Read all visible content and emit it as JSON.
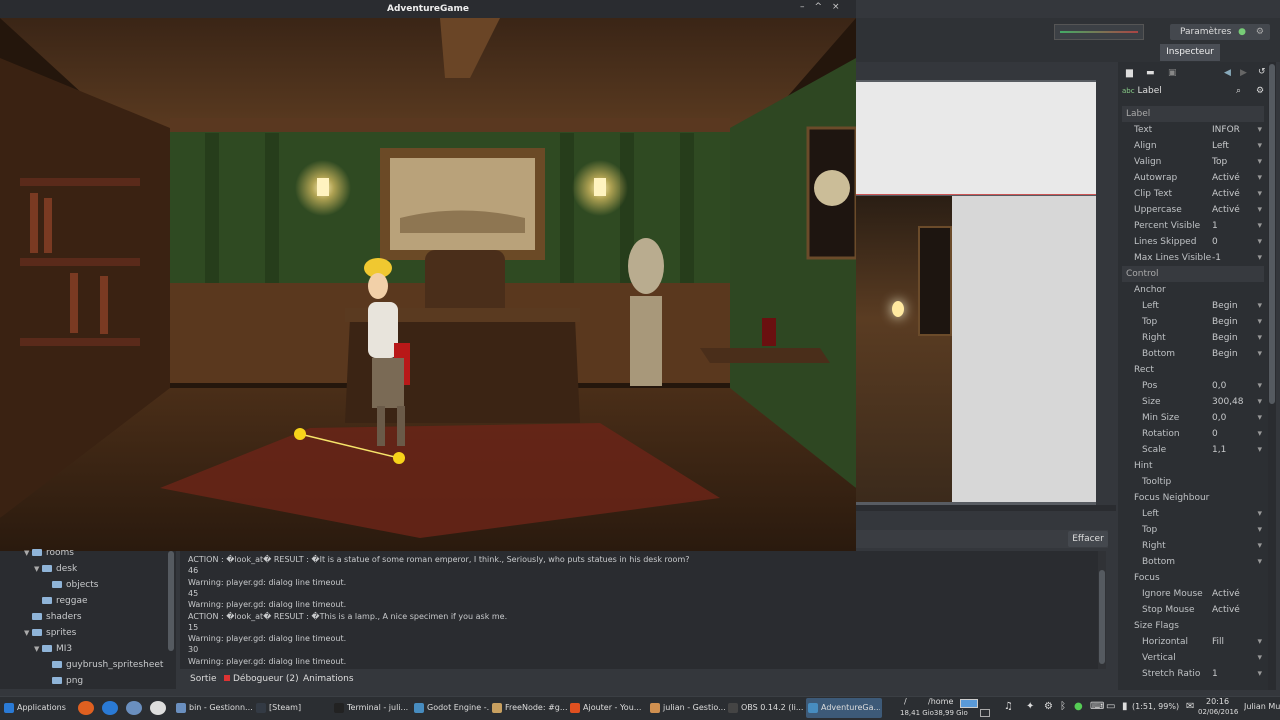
{
  "window": {
    "title": "AdventureGame",
    "controls": [
      "–",
      "^",
      "×"
    ]
  },
  "toolbar": {
    "params_label": "Paramètres",
    "inspector_tab": "Inspecteur"
  },
  "inspector": {
    "node": "Label",
    "section_label": "Label",
    "props": [
      {
        "k": "Text",
        "v": "INFOR"
      },
      {
        "k": "Align",
        "v": "Left"
      },
      {
        "k": "Valign",
        "v": "Top"
      },
      {
        "k": "Autowrap",
        "v": "Activé"
      },
      {
        "k": "Clip Text",
        "v": "Activé"
      },
      {
        "k": "Uppercase",
        "v": "Activé"
      },
      {
        "k": "Percent Visible",
        "v": "1"
      },
      {
        "k": "Lines Skipped",
        "v": "0"
      },
      {
        "k": "Max Lines Visible",
        "v": "-1"
      }
    ],
    "section_control": "Control",
    "anchor_label": "Anchor",
    "anchor": [
      {
        "k": "Left",
        "v": "Begin"
      },
      {
        "k": "Top",
        "v": "Begin"
      },
      {
        "k": "Right",
        "v": "Begin"
      },
      {
        "k": "Bottom",
        "v": "Begin"
      }
    ],
    "rect_label": "Rect",
    "rect": [
      {
        "k": "Pos",
        "v": "0,0"
      },
      {
        "k": "Size",
        "v": "300,48"
      },
      {
        "k": "Min Size",
        "v": "0,0"
      },
      {
        "k": "Rotation",
        "v": "0"
      },
      {
        "k": "Scale",
        "v": "1,1"
      }
    ],
    "hint_label": "Hint",
    "tooltip": "Tooltip",
    "focus_neighbour_label": "Focus Neighbour",
    "focus_neighbour": [
      "Left",
      "Top",
      "Right",
      "Bottom"
    ],
    "focus_label": "Focus",
    "focus": [
      {
        "k": "Ignore Mouse",
        "v": "Activé"
      },
      {
        "k": "Stop Mouse",
        "v": "Activé"
      }
    ],
    "size_flags_label": "Size Flags",
    "size_flags": [
      {
        "k": "Horizontal",
        "v": "Fill"
      },
      {
        "k": "Vertical",
        "v": ""
      },
      {
        "k": "Stretch Ratio",
        "v": "1"
      }
    ]
  },
  "output": {
    "clear_label": "Effacer",
    "lines": [
      "ACTION : �look_at� RESULT : �It is a statue of some roman emperor, I think., Seriously, who puts statues in his desk room?",
      "46",
      "Warning: player.gd: dialog line timeout.",
      "45",
      "Warning: player.gd: dialog line timeout.",
      "ACTION : �look_at� RESULT : �This is a lamp., A nice specimen if you ask me.",
      "15",
      "Warning: player.gd: dialog line timeout.",
      "30",
      "Warning: player.gd: dialog line timeout."
    ],
    "tabs": [
      "Sortie",
      "Débogueur (2)",
      "Animations"
    ]
  },
  "tree": [
    {
      "label": "rooms",
      "indent": 1,
      "folder": true,
      "open": true
    },
    {
      "label": "desk",
      "indent": 2,
      "folder": true,
      "open": true
    },
    {
      "label": "objects",
      "indent": 3,
      "folder": true,
      "open": false
    },
    {
      "label": "reggae",
      "indent": 2,
      "folder": true,
      "open": false
    },
    {
      "label": "shaders",
      "indent": 1,
      "folder": true,
      "open": false
    },
    {
      "label": "sprites",
      "indent": 1,
      "folder": true,
      "open": true
    },
    {
      "label": "MI3",
      "indent": 2,
      "folder": true,
      "open": true
    },
    {
      "label": "guybrush_spritesheet",
      "indent": 3,
      "folder": true,
      "open": false
    },
    {
      "label": "png",
      "indent": 3,
      "folder": true,
      "open": false
    }
  ],
  "taskbar": {
    "items": [
      {
        "label": "Applications",
        "color": "#2a7ad5"
      },
      {
        "label": "bin - Gestionn...",
        "color": "#6a8fbf"
      },
      {
        "label": "[Steam]",
        "color": "#333a44"
      },
      {
        "label": "Terminal - juli...",
        "color": "#222"
      },
      {
        "label": "Godot Engine -...",
        "color": "#478cbf"
      },
      {
        "label": "FreeNode: #g...",
        "color": "#c8a060"
      },
      {
        "label": "Ajouter - You...",
        "color": "#e05020"
      },
      {
        "label": "julian - Gestio...",
        "color": "#d09050"
      },
      {
        "label": "OBS 0.14.2 (li...",
        "color": "#444"
      },
      {
        "label": "AdventureGa...",
        "color": "#478cbf"
      }
    ],
    "path_top": "/",
    "home": "/home",
    "disk": "18,41 Gio38,99 Gio",
    "battery": "(1:51, 99%)",
    "time": "20:16",
    "date": "02/06/2016",
    "user": "Julian Murgia"
  }
}
